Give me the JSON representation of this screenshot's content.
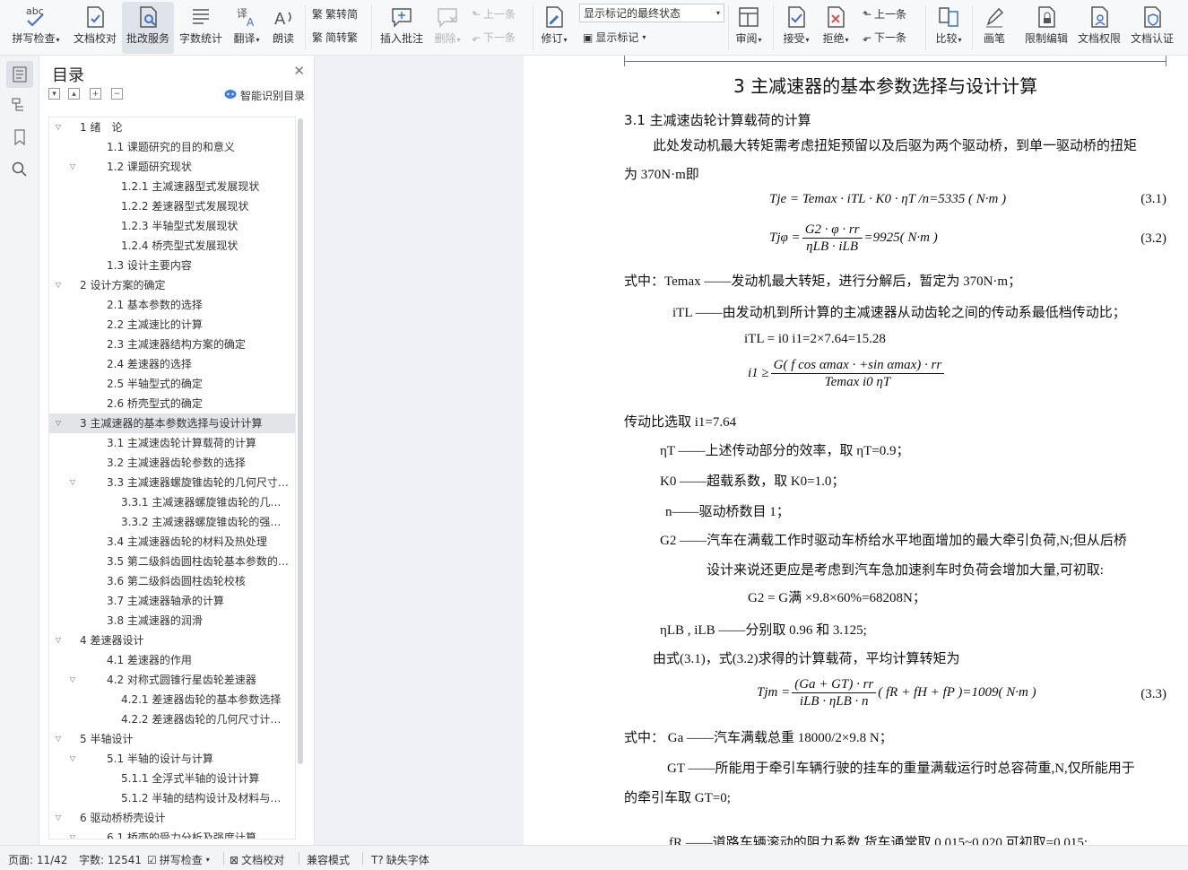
{
  "ribbon": {
    "spell": "拼写检查",
    "proof": "文档校对",
    "batch": "批改服务",
    "wordcount": "字数统计",
    "translate": "翻译",
    "read": "朗读",
    "t2s": "繁转简",
    "s2t": "简转繁",
    "insert_comment": "插入批注",
    "delete": "删除",
    "prev": "上一条",
    "next": "下一条",
    "revise": "修订",
    "markup_select": "显示标记的最终状态",
    "show_markup": "显示标记",
    "review": "审阅",
    "accept": "接受",
    "reject": "拒绝",
    "prev2": "上一条",
    "next2": "下一条",
    "compare": "比较",
    "pen": "画笔",
    "restrict": "限制编辑",
    "permission": "文档权限",
    "certify": "文档认证"
  },
  "toc": {
    "title": "目录",
    "ai_label": "智能识别目录",
    "items": [
      {
        "text": "1 绪　论",
        "level": 1,
        "caret": "v"
      },
      {
        "text": "1.1  课题研究的目的和意义",
        "level": 2,
        "caret": ""
      },
      {
        "text": "1.2  课题研究现状",
        "level": 2,
        "caret": "v"
      },
      {
        "text": "1.2.1 主减速器型式发展现状",
        "level": 3,
        "caret": ""
      },
      {
        "text": "1.2.2 差速器型式发展现状",
        "level": 3,
        "caret": ""
      },
      {
        "text": "1.2.3 半轴型式发展现状",
        "level": 3,
        "caret": ""
      },
      {
        "text": "1.2.4 桥壳型式发展现状",
        "level": 3,
        "caret": ""
      },
      {
        "text": "1.3  设计主要内容",
        "level": 2,
        "caret": ""
      },
      {
        "text": "2  设计方案的确定",
        "level": 1,
        "caret": "v"
      },
      {
        "text": "2.1  基本参数的选择",
        "level": 2,
        "caret": ""
      },
      {
        "text": "2.2  主减速比的计算",
        "level": 2,
        "caret": ""
      },
      {
        "text": "2.3  主减速器结构方案的确定",
        "level": 2,
        "caret": ""
      },
      {
        "text": "2.4  差速器的选择",
        "level": 2,
        "caret": ""
      },
      {
        "text": "2.5  半轴型式的确定",
        "level": 2,
        "caret": ""
      },
      {
        "text": "2.6  桥壳型式的确定",
        "level": 2,
        "caret": ""
      },
      {
        "text": "3  主减速器的基本参数选择与设计计算",
        "level": 1,
        "caret": "v",
        "selected": true
      },
      {
        "text": "3.1  主减速齿轮计算载荷的计算",
        "level": 2,
        "caret": ""
      },
      {
        "text": "3.2  主减速器齿轮参数的选择",
        "level": 2,
        "caret": ""
      },
      {
        "text": "3.3  主减速器螺旋锥齿轮的几何尺寸计算 ...",
        "level": 2,
        "caret": "v"
      },
      {
        "text": "3.3.1  主减速器螺旋锥齿轮的几何尺寸 ...",
        "level": 3,
        "caret": ""
      },
      {
        "text": "3.3.2  主减速器螺旋锥齿轮的强度计算",
        "level": 3,
        "caret": ""
      },
      {
        "text": "3.4  主减速器齿轮的材料及热处理",
        "level": 2,
        "caret": ""
      },
      {
        "text": "3.5  第二级斜齿圆柱齿轮基本参数的选择",
        "level": 2,
        "caret": ""
      },
      {
        "text": "3.6  第二级斜齿圆柱齿轮校核",
        "level": 2,
        "caret": ""
      },
      {
        "text": "3.7  主减速器轴承的计算",
        "level": 2,
        "caret": ""
      },
      {
        "text": "3.8  主减速器的润滑",
        "level": 2,
        "caret": ""
      },
      {
        "text": "4  差速器设计",
        "level": 1,
        "caret": "v"
      },
      {
        "text": "4.1  差速器的作用",
        "level": 2,
        "caret": ""
      },
      {
        "text": "4.2  对称式圆锥行星齿轮差速器",
        "level": 2,
        "caret": "v"
      },
      {
        "text": "4.2.1  差速器齿轮的基本参数选择",
        "level": 3,
        "caret": ""
      },
      {
        "text": "4.2.2  差速器齿轮的几何尺寸计算与强...",
        "level": 3,
        "caret": ""
      },
      {
        "text": "5  半轴设计",
        "level": 1,
        "caret": "v"
      },
      {
        "text": "5.1  半轴的设计与计算",
        "level": 2,
        "caret": "v"
      },
      {
        "text": "5.1.1  全浮式半轴的设计计算",
        "level": 3,
        "caret": ""
      },
      {
        "text": "5.1.2  半轴的结构设计及材料与热处理",
        "level": 3,
        "caret": ""
      },
      {
        "text": "6  驱动桥桥壳设计",
        "level": 1,
        "caret": "v"
      },
      {
        "text": "6.1  桥壳的受力分析及强度计算",
        "level": 2,
        "caret": "v"
      }
    ]
  },
  "doc": {
    "heading": "3  主减速器的基本参数选择与设计计算",
    "sub": "3.1  主减速齿轮计算载荷的计算",
    "p1a": "此处发动机最大转矩需考虑扭矩预留以及后驱为两个驱动桥，到单一驱动桥的扭矩",
    "p1b": "为 370N·m即",
    "eq1": "Tje = Temax · iTL · K0 · ηT /n=5335 ( N·m )",
    "eq1n": "(3.1)",
    "eq2l": "Tjφ =",
    "eq2n_top": "G2 · φ · rr",
    "eq2d": "ηLB · iLB",
    "eq2r": "=9925( N·m )",
    "eq2n": "(3.2)",
    "l1": "式中：Temax ——发动机最大转矩，进行分解后，暂定为 370N·m；",
    "l2": "iTL ——由发动机到所计算的主减速器从动齿轮之间的传动系最低档传动比；",
    "l3": "iTL = i0 i1=2×7.64=15.28",
    "eq3l": "i1 ≥",
    "eq3n": "G( f cos αmax · +sin αmax) · rr",
    "eq3d": "Temax i0 ηT",
    "l4": "传动比选取 i1=7.64",
    "l5": "ηT ——上述传动部分的效率，取 ηT=0.9；",
    "l6": "K0 ——超载系数，取 K0=1.0；",
    "l7": "n——驱动桥数目 1；",
    "l8": "G2 ——汽车在满载工作时驱动车桥给水平地面增加的最大牵引负荷,N;但从后桥",
    "l9": "设计来说还更应是考虑到汽车急加速刹车时负荷会增加大量,可初取:",
    "l10": "G2 = G满 ×9.8×60%=68208N；",
    "l11": "ηLB , iLB ——分别取 0.96 和 3.125;",
    "l12": "由式(3.1)，式(3.2)求得的计算载荷，平均计算转矩为",
    "eq4l": "Tjm =",
    "eq4n_top": "(Ga + GT) · rr",
    "eq4d": "iLB · ηLB · n",
    "eq4r": "( fR + fH + fP )=1009( N·m )",
    "eq4n": "(3.3)",
    "l13": "式中：  Ga ——汽车满载总重 18000/2×9.8 N；",
    "l14": "GT ——所能用于牵引车辆行驶的挂车的重量满载运行时总容荷重,N,仅所能用于",
    "l15": "的牵引车取 GT=0;",
    "l16": "fR ——道路车辆滚动的阻力系数,货车通常取 0.015~0.020,可初取=0.015;"
  },
  "status": {
    "page": "页面: 11/42",
    "words": "字数: 12541",
    "spell": "拼写检查",
    "proof": "文档校对",
    "compat": "兼容模式",
    "missing_font": "缺失字体"
  }
}
